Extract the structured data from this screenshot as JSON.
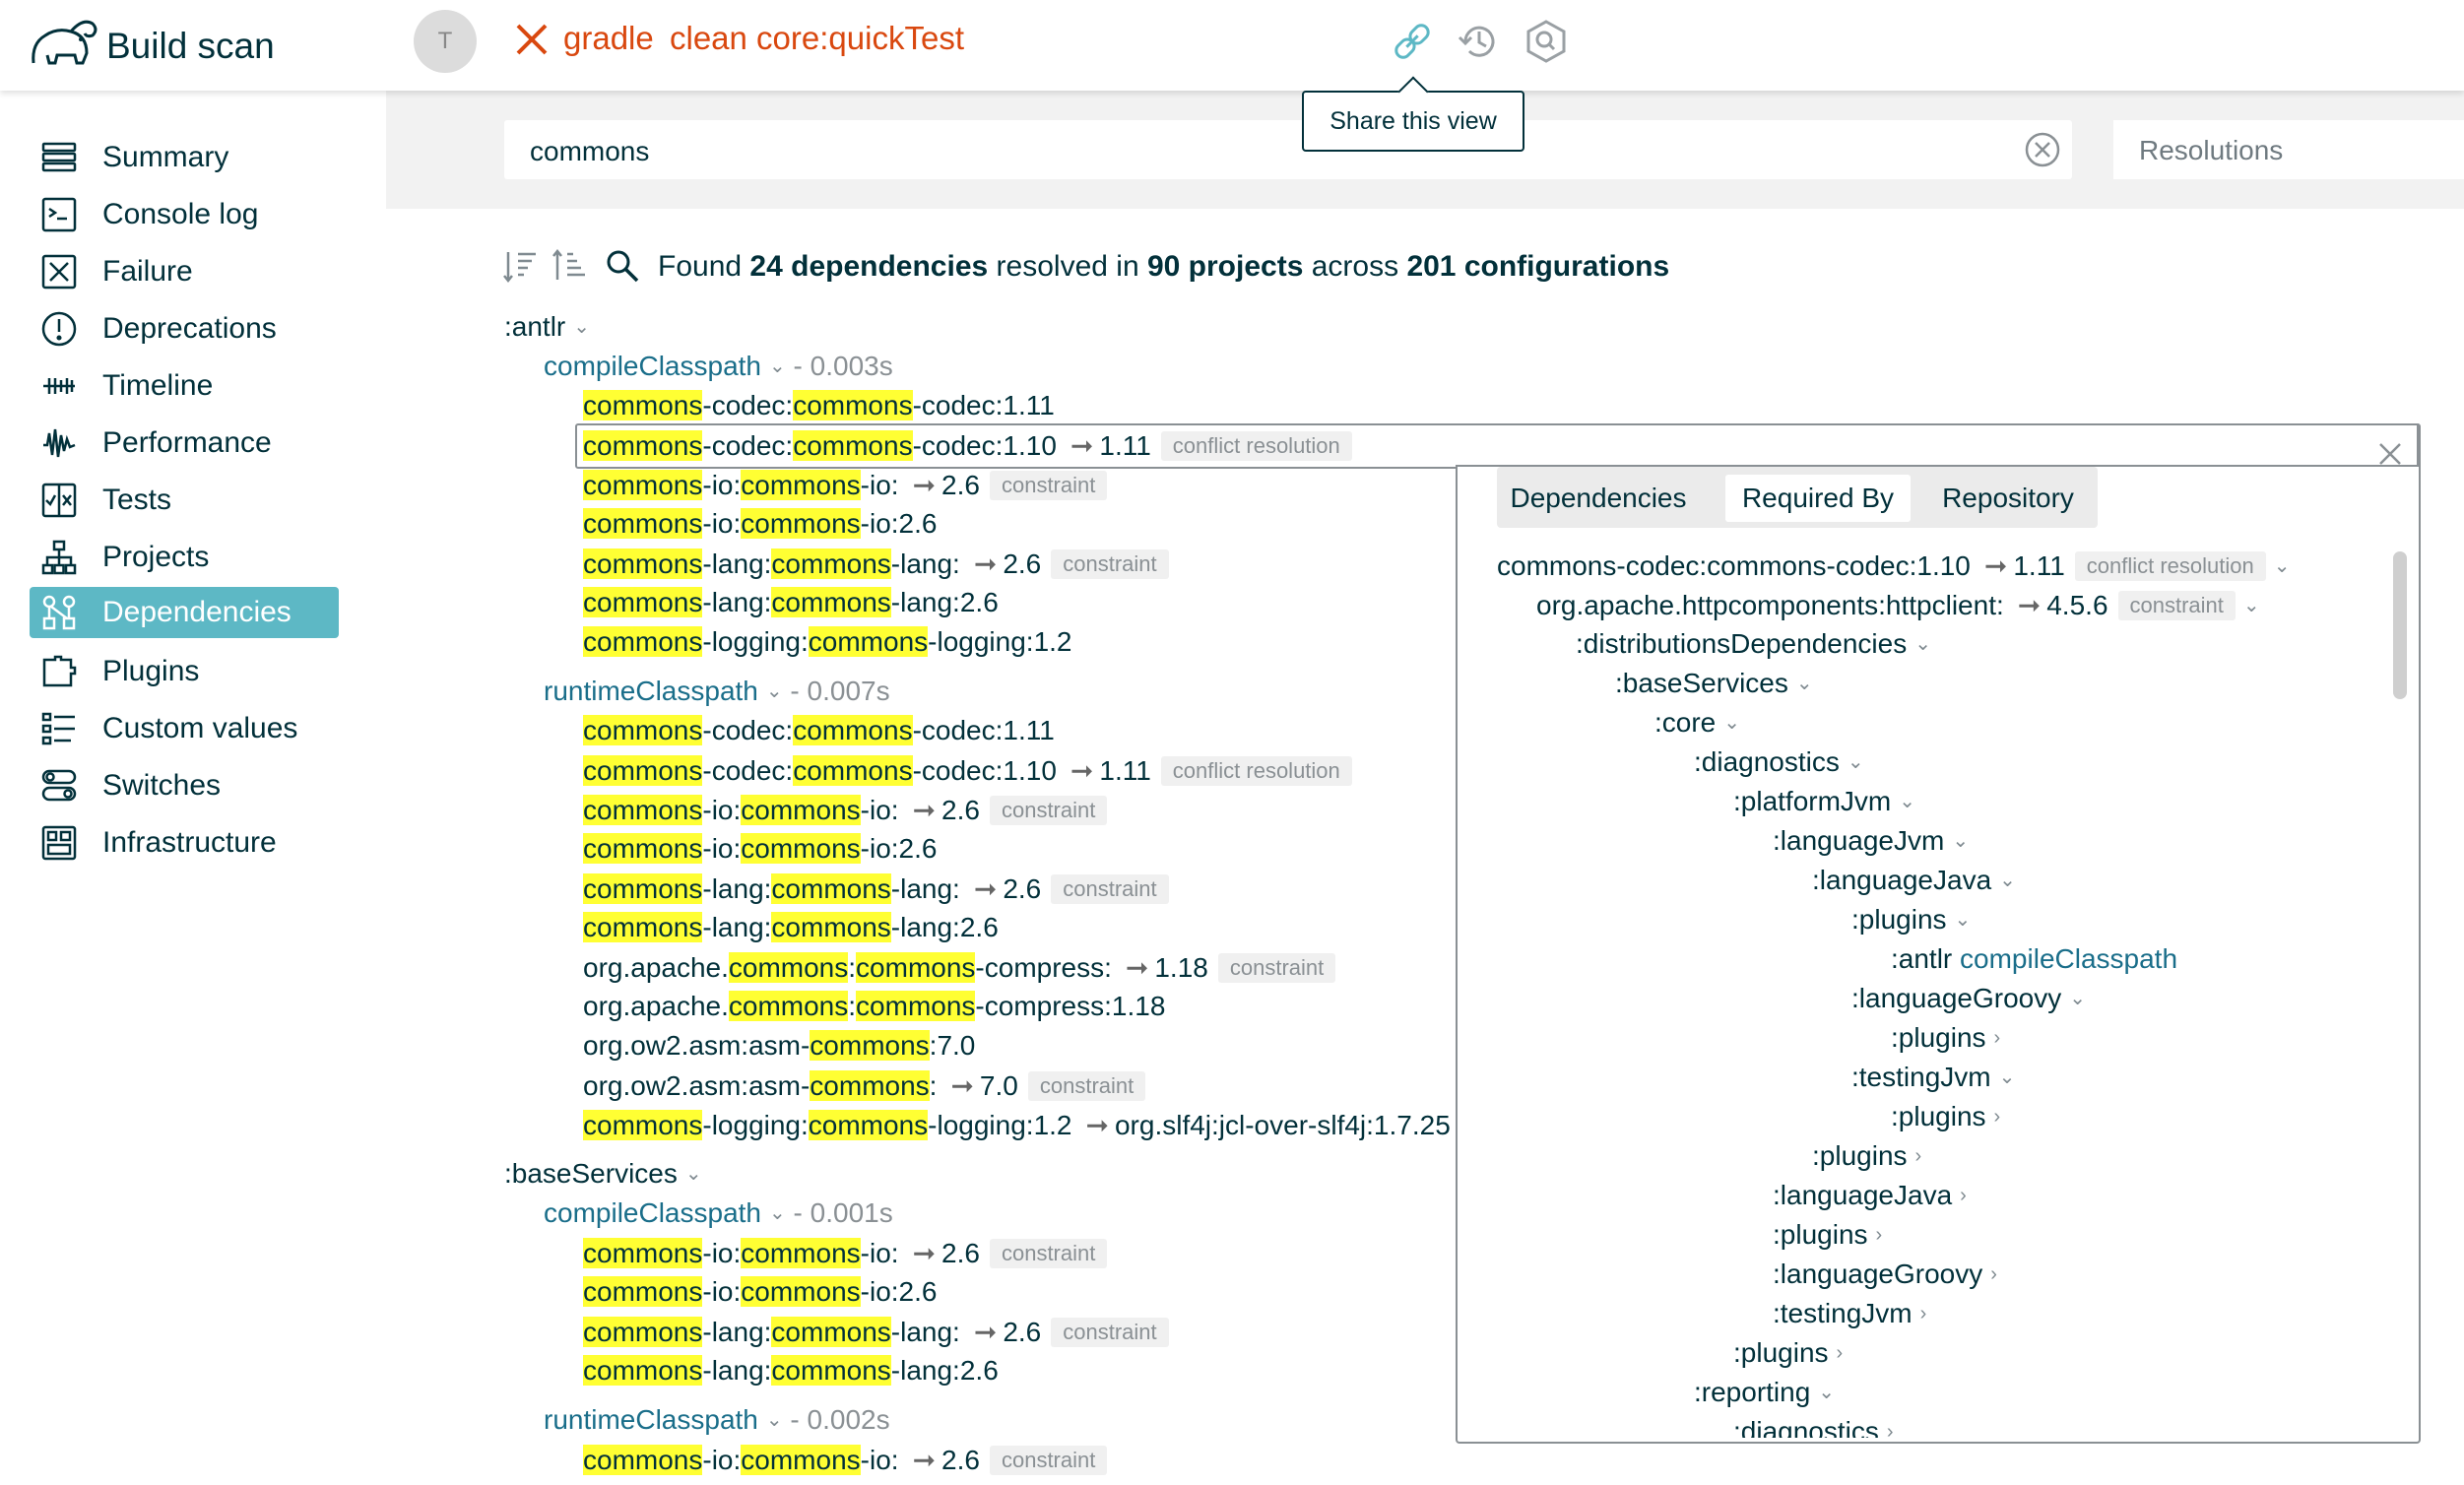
{
  "header": {
    "app_title": "Build scan",
    "avatar_initial": "T",
    "build_tool": "gradle",
    "build_tasks": "clean core:quickTest",
    "tooltip": "Share this view"
  },
  "sidebar": {
    "items": [
      {
        "label": "Summary",
        "icon": "list-icon"
      },
      {
        "label": "Console log",
        "icon": "terminal-icon"
      },
      {
        "label": "Failure",
        "icon": "failure-icon"
      },
      {
        "label": "Deprecations",
        "icon": "warning-icon"
      },
      {
        "label": "Timeline",
        "icon": "timeline-icon"
      },
      {
        "label": "Performance",
        "icon": "performance-icon"
      },
      {
        "label": "Tests",
        "icon": "tests-icon"
      },
      {
        "label": "Projects",
        "icon": "projects-icon"
      },
      {
        "label": "Dependencies",
        "icon": "dependencies-icon",
        "active": true
      },
      {
        "label": "Plugins",
        "icon": "plugin-icon"
      },
      {
        "label": "Custom values",
        "icon": "custom-values-icon"
      },
      {
        "label": "Switches",
        "icon": "switches-icon"
      },
      {
        "label": "Infrastructure",
        "icon": "infrastructure-icon"
      }
    ]
  },
  "search": {
    "value": "commons",
    "resolutions_placeholder": "Resolutions"
  },
  "summary": {
    "prefix": "Found",
    "deps_count": "24 dependencies",
    "mid1": "resolved in",
    "projects_count": "90 projects",
    "mid2": "across",
    "configs_count": "201 configurations"
  },
  "tree": {
    "antlr": {
      "name": ":antlr",
      "compile": {
        "name": "compileClasspath",
        "time": "- 0.003s"
      },
      "runtime": {
        "name": "runtimeClasspath",
        "time": "- 0.007s"
      }
    },
    "baseServices": {
      "name": ":baseServices",
      "compile": {
        "name": "compileClasspath",
        "time": "- 0.001s"
      },
      "runtime": {
        "name": "runtimeClasspath",
        "time": "- 0.002s"
      }
    },
    "labels": {
      "conflict": "conflict resolution",
      "constraint": "constraint",
      "v111": "1.11",
      "v26": "2.6",
      "v118": "1.18",
      "v70": "7.0",
      "slf4j": "org.slf4j:jcl-over-slf4j:1.7.25",
      "compress": "org.apache.commons:commons-compress:1.18"
    }
  },
  "detail": {
    "tabs": [
      "Dependencies",
      "Required By",
      "Repository"
    ],
    "active_tab": "Required By",
    "root": "commons-codec:commons-codec:1.10",
    "root_to": "1.11",
    "root_tag": "conflict resolution",
    "httpclient": "org.apache.httpcomponents:httpclient:",
    "httpclient_to": "4.5.6",
    "httpclient_tag": "constraint",
    "nodes": [
      ":distributionsDependencies",
      ":baseServices",
      ":core",
      ":diagnostics",
      ":platformJvm",
      ":languageJvm",
      ":languageJava",
      ":plugins",
      ":antlr",
      ":languageGroovy",
      ":plugins",
      ":testingJvm",
      ":plugins",
      ":plugins",
      ":languageJava",
      ":plugins",
      ":languageGroovy",
      ":testingJvm",
      ":plugins",
      ":reporting",
      ":diagnostics"
    ],
    "antlr_conf": "compileClasspath"
  }
}
